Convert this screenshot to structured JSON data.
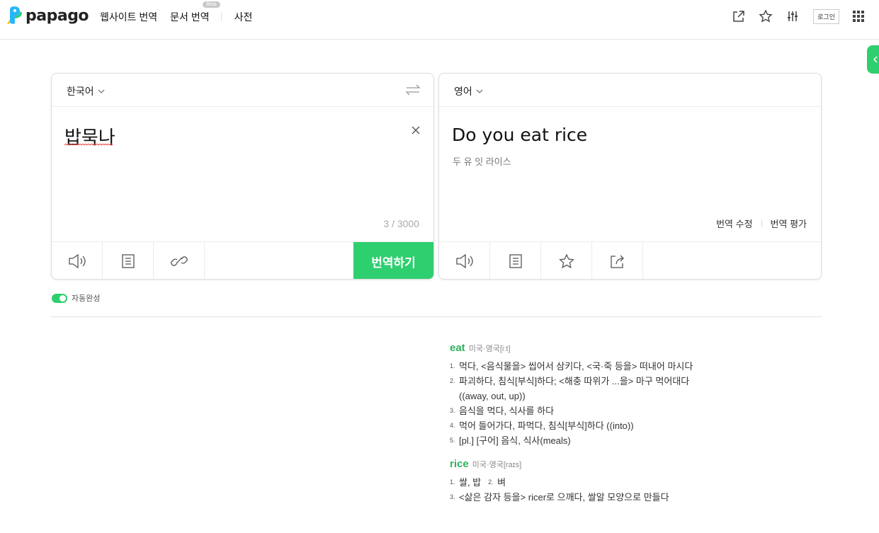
{
  "header": {
    "logo_text": "papago",
    "nav": [
      {
        "label": "웹사이트 번역"
      },
      {
        "label": "문서 번역",
        "badge": "Beta"
      },
      {
        "label": "사전"
      }
    ],
    "login_label": "로그인"
  },
  "source": {
    "language": "한국어",
    "text": "밥묵나",
    "count": "3 / 3000",
    "translate_label": "번역하기"
  },
  "target": {
    "language": "영어",
    "text": "Do you eat rice",
    "pronunciation": "두 유 잇 라이스",
    "edit_label": "번역 수정",
    "rate_label": "번역 평가"
  },
  "autocomplete_label": "자동완성",
  "dictionary": [
    {
      "word": "eat",
      "phonetic": "미국·영국[iːt]",
      "definitions": [
        {
          "num": "1.",
          "text": "먹다, <음식물을> 씹어서 삼키다, <국·죽 등을> 떠내어 마시다"
        },
        {
          "num": "2.",
          "text": "파괴하다, 침식[부식]하다; <해충 따위가 ...을> 마구 먹어대다 ((away, out, up))"
        },
        {
          "num": "3.",
          "text": "음식을 먹다, 식사를 하다"
        },
        {
          "num": "4.",
          "text": "먹어 들어가다, 파먹다, 침식[부식]하다 ((into))"
        },
        {
          "num": "5.",
          "text": "[pl.] [구어] 음식, 식사(meals)"
        }
      ]
    },
    {
      "word": "rice",
      "phonetic": "미국·영국[raɪs]",
      "inline": [
        {
          "num": "1.",
          "text": "쌀, 밥"
        },
        {
          "num": "2.",
          "text": "벼"
        }
      ],
      "definitions": [
        {
          "num": "3.",
          "text": "<삶은 감자 등을> ricer로 으깨다, 쌀알 모양으로 만들다"
        }
      ]
    }
  ],
  "colors": {
    "brand": "#2ecf6f",
    "dict_word": "#2eb15c"
  }
}
